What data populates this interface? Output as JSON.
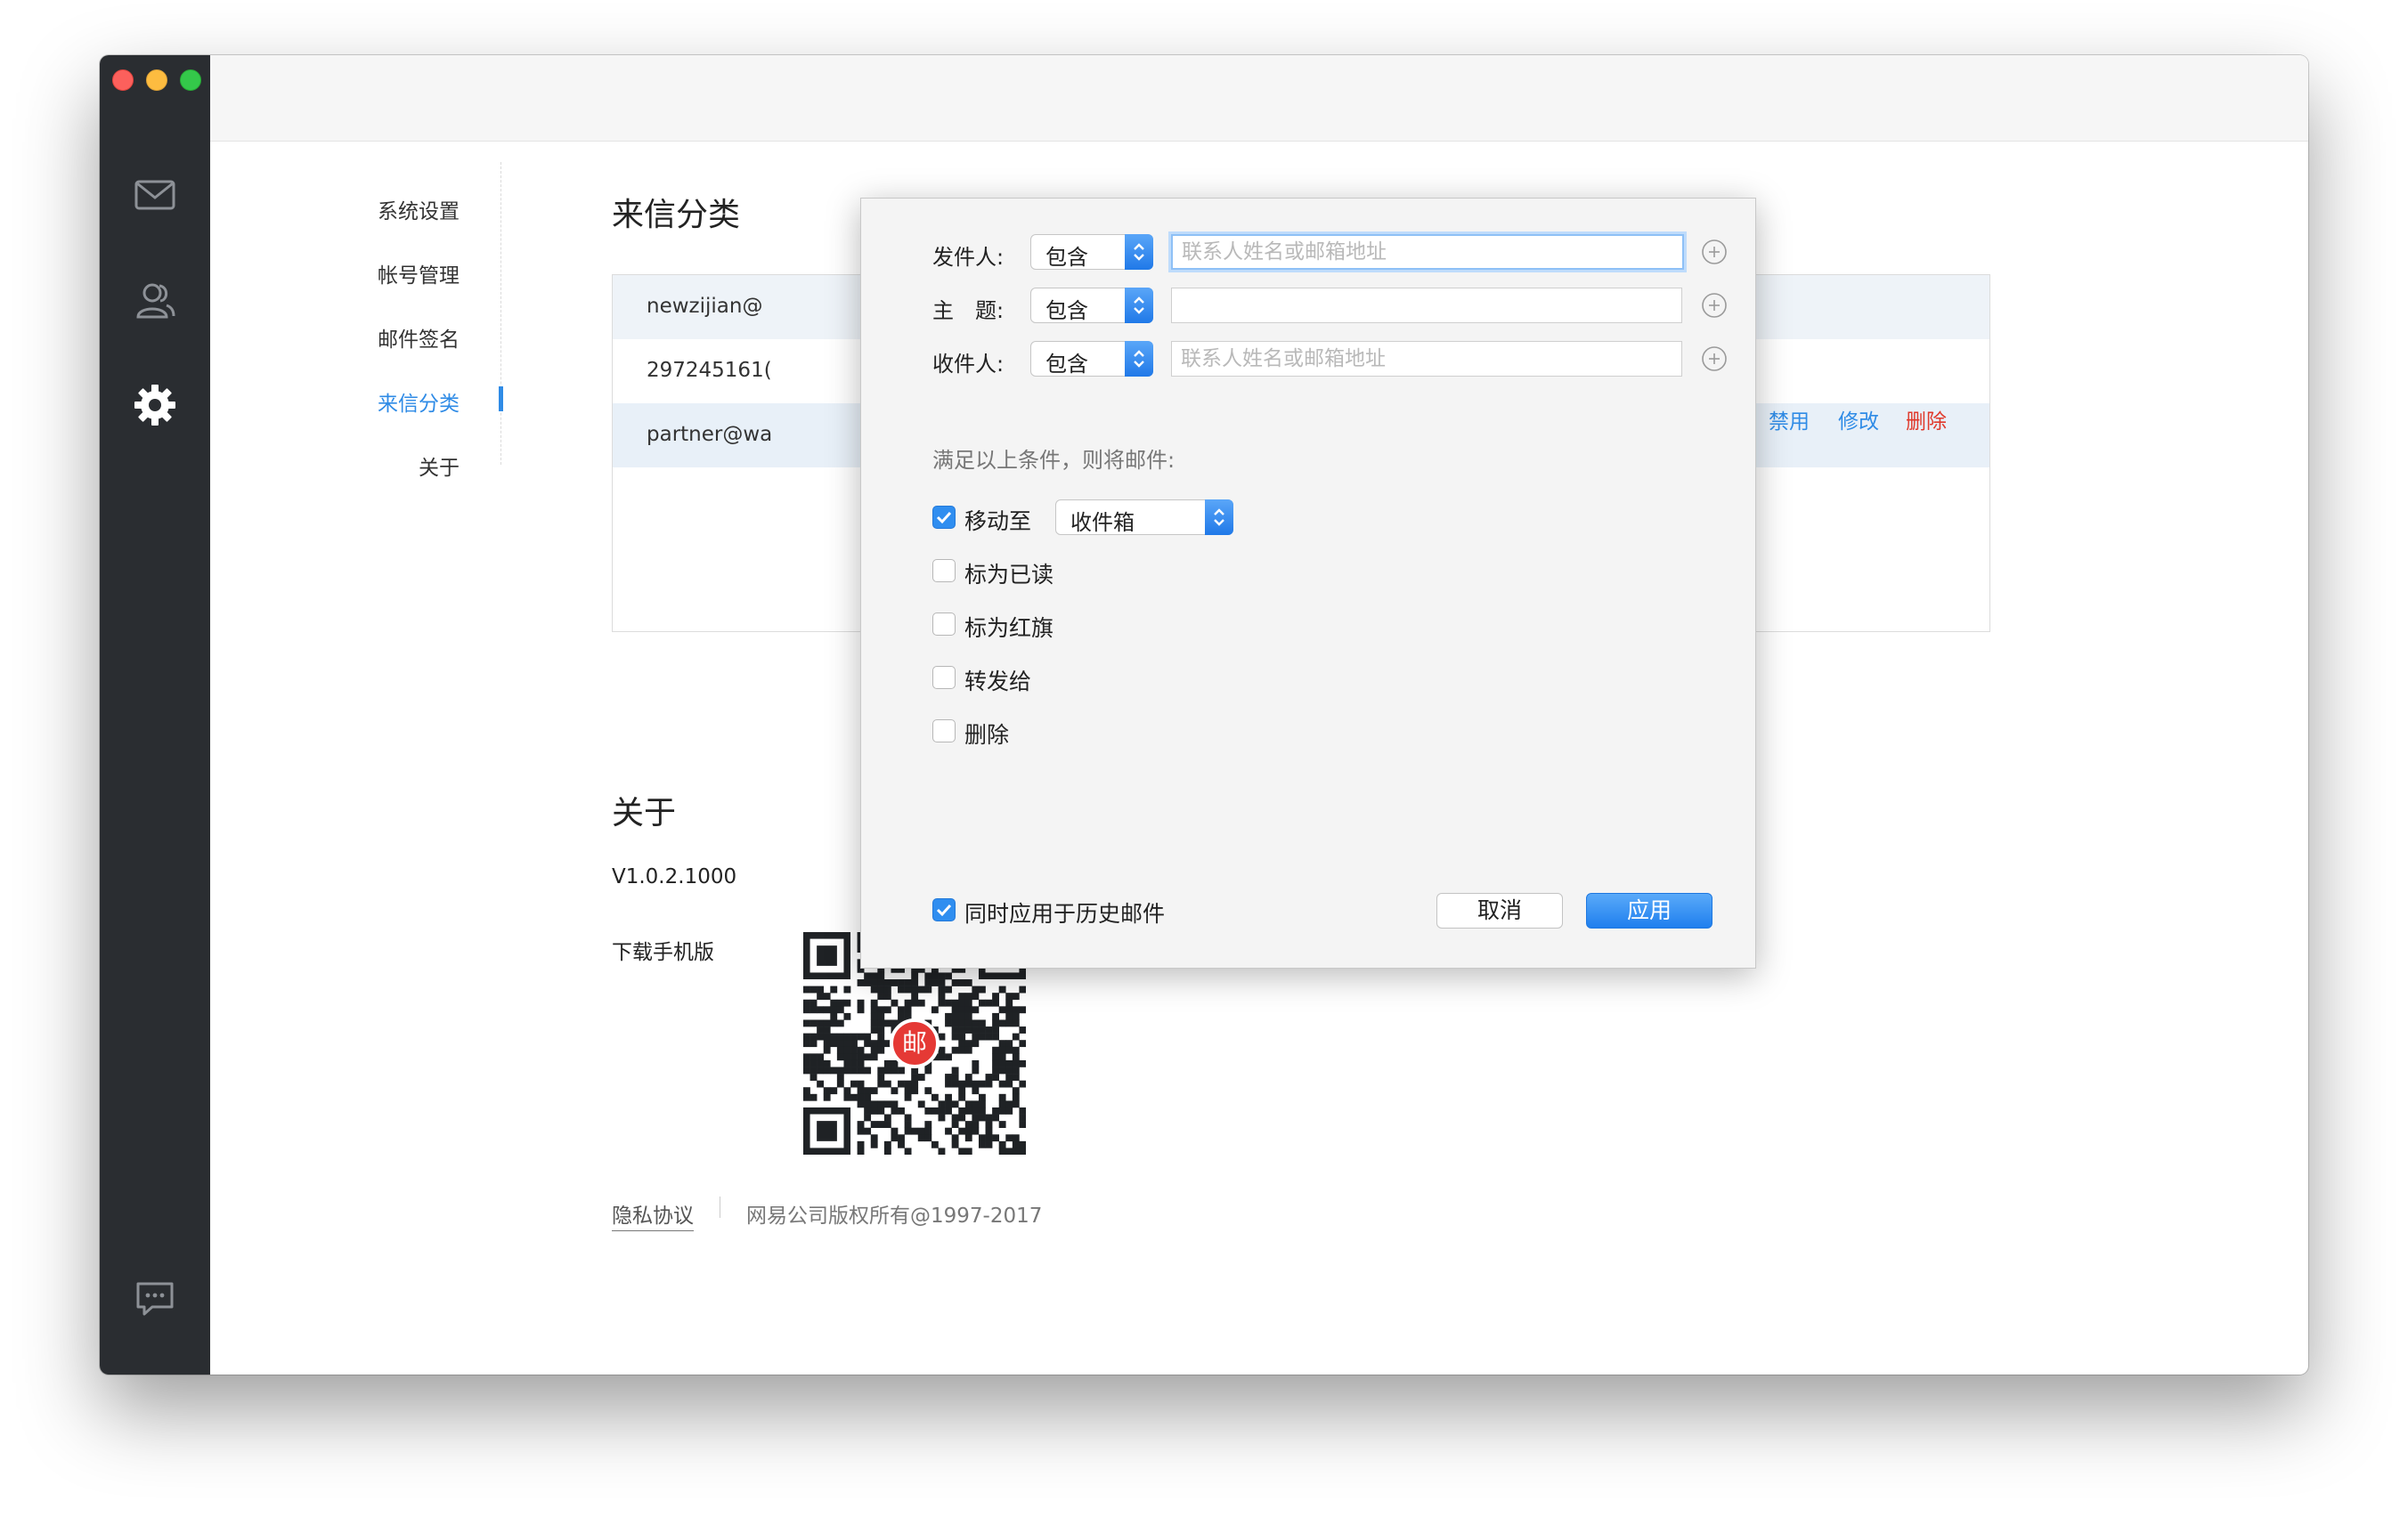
{
  "nav": {
    "items": [
      {
        "label": "系统设置"
      },
      {
        "label": "帐号管理"
      },
      {
        "label": "邮件签名"
      },
      {
        "label": "来信分类"
      },
      {
        "label": "关于"
      }
    ],
    "active": "来信分类"
  },
  "icons": [
    "mail-icon",
    "contacts-icon",
    "settings-gear-icon",
    "feedback-chat-icon"
  ],
  "filters": {
    "title": "来信分类",
    "rules": [
      {
        "address": "newzijian@"
      },
      {
        "address": "297245161("
      },
      {
        "address": "partner@wa"
      }
    ],
    "actions": {
      "disable": "禁用",
      "edit": "修改",
      "delete": "删除"
    }
  },
  "about": {
    "title": "关于",
    "version": "V1.0.2.1000",
    "download_label": "下载手机版",
    "qr_badge": "邮",
    "privacy": "隐私协议",
    "copyright": "网易公司版权所有@1997-2017"
  },
  "dialog": {
    "conditions": [
      {
        "label": "发件人:",
        "operator": "包含",
        "placeholder": "联系人姓名或邮箱地址",
        "value": ""
      },
      {
        "label": "主　题:",
        "operator": "包含",
        "placeholder": "",
        "value": ""
      },
      {
        "label": "收件人:",
        "operator": "包含",
        "placeholder": "联系人姓名或邮箱地址",
        "value": ""
      }
    ],
    "hint": "满足以上条件，则将邮件:",
    "actions": [
      {
        "label": "移动至",
        "checked": true,
        "target": "收件箱"
      },
      {
        "label": "标为已读",
        "checked": false
      },
      {
        "label": "标为红旗",
        "checked": false
      },
      {
        "label": "转发给",
        "checked": false
      },
      {
        "label": "删除",
        "checked": false
      }
    ],
    "apply_history": {
      "label": "同时应用于历史邮件",
      "checked": true
    },
    "cancel_label": "取消",
    "apply_label": "应用"
  },
  "colors": {
    "accent": "#2f8be6",
    "danger": "#e0392b",
    "sidebar": "#2a2d31"
  }
}
